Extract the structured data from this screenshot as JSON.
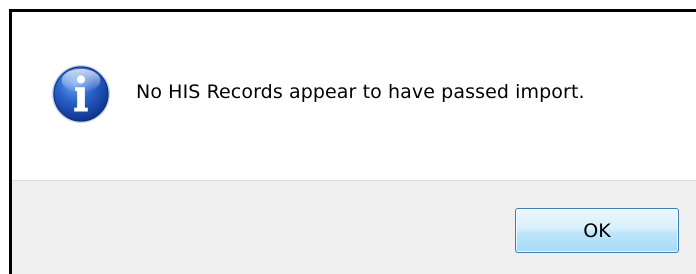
{
  "dialog": {
    "icon": "info-icon",
    "message": "No HIS Records appear to have passed import.",
    "ok_label": "OK"
  }
}
